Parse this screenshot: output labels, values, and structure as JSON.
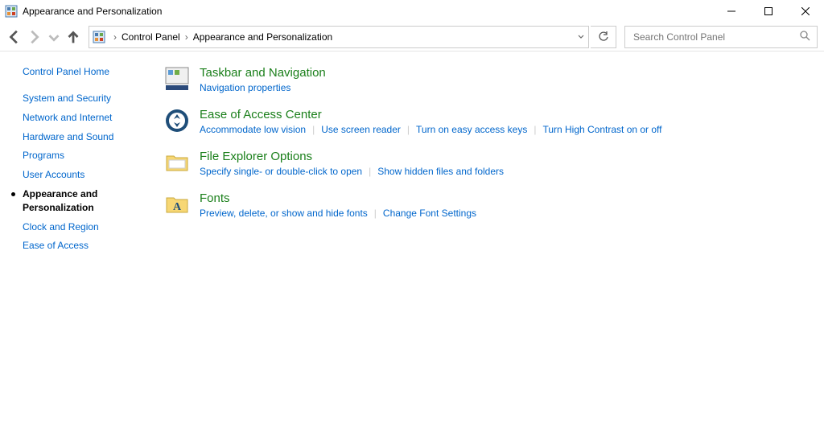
{
  "window": {
    "title": "Appearance and Personalization"
  },
  "breadcrumb": {
    "root": "Control Panel",
    "current": "Appearance and Personalization"
  },
  "search": {
    "placeholder": "Search Control Panel"
  },
  "sidebar": {
    "home": "Control Panel Home",
    "items": [
      {
        "label": "System and Security"
      },
      {
        "label": "Network and Internet"
      },
      {
        "label": "Hardware and Sound"
      },
      {
        "label": "Programs"
      },
      {
        "label": "User Accounts"
      },
      {
        "label": "Appearance and Personalization",
        "current": true
      },
      {
        "label": "Clock and Region"
      },
      {
        "label": "Ease of Access"
      }
    ]
  },
  "categories": [
    {
      "id": "taskbar",
      "title": "Taskbar and Navigation",
      "links": [
        "Navigation properties"
      ]
    },
    {
      "id": "ease",
      "title": "Ease of Access Center",
      "links": [
        "Accommodate low vision",
        "Use screen reader",
        "Turn on easy access keys",
        "Turn High Contrast on or off"
      ]
    },
    {
      "id": "explorer",
      "title": "File Explorer Options",
      "links": [
        "Specify single- or double-click to open",
        "Show hidden files and folders"
      ]
    },
    {
      "id": "fonts",
      "title": "Fonts",
      "links": [
        "Preview, delete, or show and hide fonts",
        "Change Font Settings"
      ]
    }
  ]
}
